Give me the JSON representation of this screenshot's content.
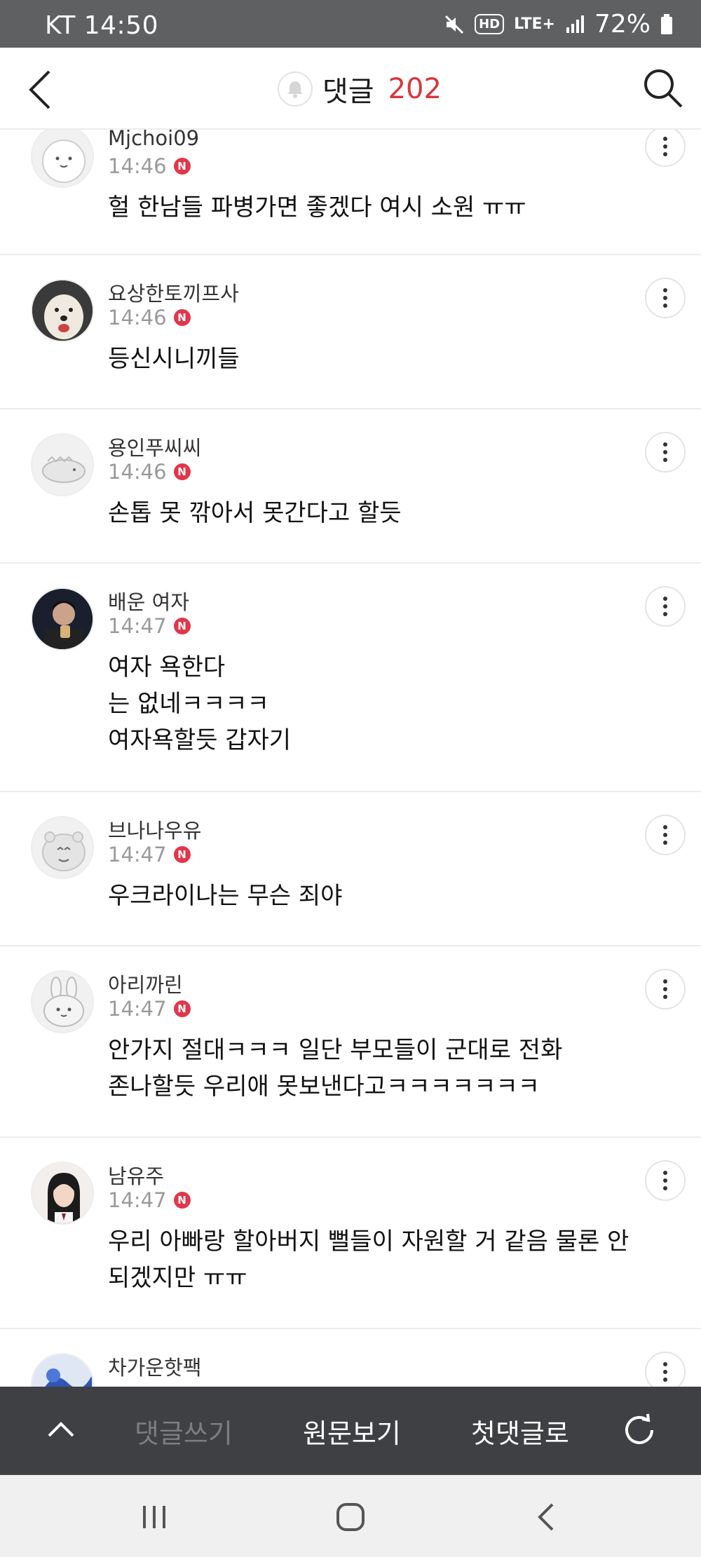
{
  "status_bar": {
    "carrier_time": "KT 14:50",
    "battery": "72%",
    "hd_label": "HD",
    "lte_label": "LTE+"
  },
  "header": {
    "title": "댓글",
    "count": "202"
  },
  "comments": [
    {
      "nickname": "Mjchoi09",
      "time": "14:46",
      "badge": "N",
      "text": "헐 한남들 파병가면 좋겠다 여시 소원 ㅠㅠ"
    },
    {
      "nickname": "요상한토끼프사",
      "time": "14:46",
      "badge": "N",
      "text": "등신시니끼들"
    },
    {
      "nickname": "용인푸씨씨",
      "time": "14:46",
      "badge": "N",
      "text": "손톱 못 깎아서 못간다고 할듯"
    },
    {
      "nickname": "배운 여자",
      "time": "14:47",
      "badge": "N",
      "text": "여자 욕한다\n는 없네ㅋㅋㅋㅋ\n여자욕할듯 갑자기"
    },
    {
      "nickname": "브나나우유",
      "time": "14:47",
      "badge": "N",
      "text": "우크라이나는 무슨 죄야"
    },
    {
      "nickname": "아리까린",
      "time": "14:47",
      "badge": "N",
      "text": "안가지 절대ㅋㅋㅋ 일단 부모들이 군대로 전화\n존나할듯 우리애 못보낸다고ㅋㅋㅋㅋㅋㅋㅋ"
    },
    {
      "nickname": "남유주",
      "time": "14:47",
      "badge": "N",
      "text": "우리 아빠랑 할아버지 뻘들이 자원할 거 같음 물론 안\n되겠지만 ㅠㅠ"
    },
    {
      "nickname": "차가운핫팩",
      "time": "",
      "badge": "",
      "text": ""
    }
  ],
  "toolbar": {
    "write": "댓글쓰기",
    "original": "원문보기",
    "first": "첫댓글로"
  }
}
